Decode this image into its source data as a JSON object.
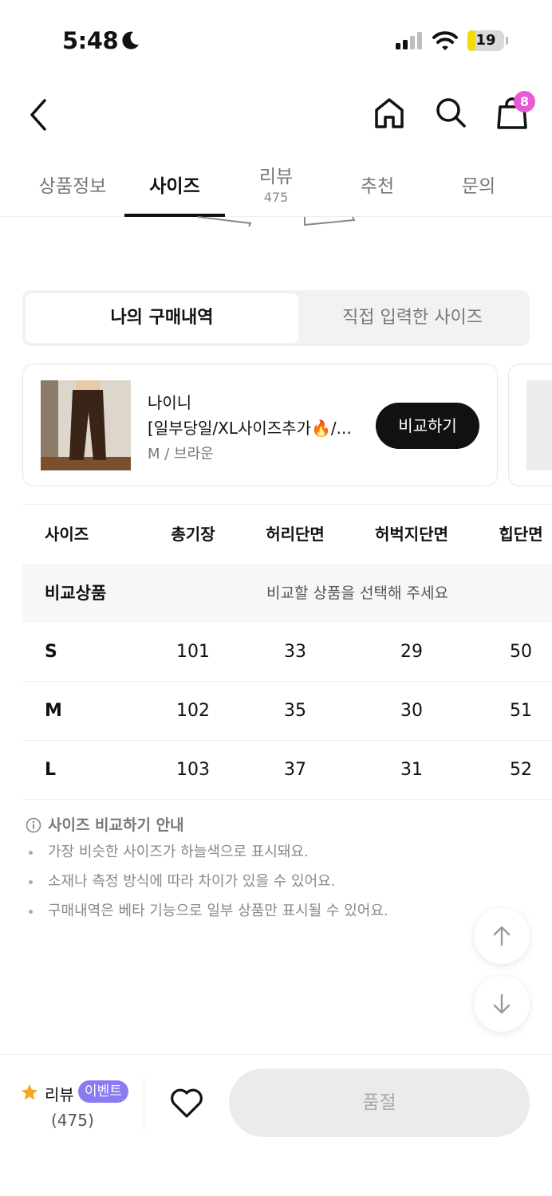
{
  "status_bar": {
    "time": "5:48",
    "battery_level": "19",
    "battery_fraction": 0.19
  },
  "header": {
    "cart_count": "8",
    "icons": [
      "back-icon",
      "home-icon",
      "search-icon",
      "cart-icon"
    ]
  },
  "tabs": [
    {
      "label": "상품정보"
    },
    {
      "label": "사이즈",
      "active": true
    },
    {
      "label": "리뷰",
      "count": "475"
    },
    {
      "label": "추천"
    },
    {
      "label": "문의"
    }
  ],
  "segment": {
    "purchase_history": "나의 구매내역",
    "entered_size": "직접 입력한 사이즈"
  },
  "product": {
    "brand": "나이니",
    "name": "[일부당일/XL사이즈추가🔥/...",
    "option": "M / 브라운",
    "compare_label": "비교하기"
  },
  "size_table": {
    "headers": [
      "사이즈",
      "총기장",
      "허리단면",
      "허벅지단면",
      "힙단면"
    ],
    "compare_row_label": "비교상품",
    "compare_row_message": "비교할 상품을 선택해 주세요",
    "rows": [
      {
        "size": "S",
        "values": [
          "101",
          "33",
          "29",
          "50"
        ]
      },
      {
        "size": "M",
        "values": [
          "102",
          "35",
          "30",
          "51"
        ]
      },
      {
        "size": "L",
        "values": [
          "103",
          "37",
          "31",
          "52"
        ]
      }
    ]
  },
  "guide": {
    "title": "사이즈 비교하기 안내",
    "items": [
      "가장 비슷한 사이즈가 하늘색으로 표시돼요.",
      "소재나 측정 방식에 따라 차이가 있을 수 있어요.",
      "구매내역은 베타 기능으로 일부 상품만 표시될 수 있어요."
    ]
  },
  "bottom_bar": {
    "review_label": "리뷰",
    "event_label": "이벤트",
    "review_count": "(475)",
    "soldout_label": "품절"
  },
  "colors": {
    "cart_badge": "#e85bd6",
    "event_badge": "#8a7bf2",
    "star": "#f5a623",
    "battery": "#f5d90a",
    "primary_button": "#111111"
  }
}
